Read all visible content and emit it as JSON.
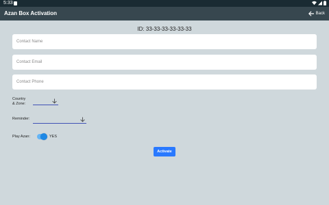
{
  "status_bar": {
    "time": "5:33",
    "icons": [
      "notification-icon",
      "wifi-icon",
      "cellular-icon",
      "battery-icon"
    ]
  },
  "app_bar": {
    "title": "Azan Box Activation",
    "back_label": "Back",
    "back_icon": "arrow-left-icon"
  },
  "device": {
    "id_text": "ID: 33-33-33-33-33-33"
  },
  "form": {
    "contact_name_placeholder": "Contact Name",
    "contact_email_placeholder": "Contact Email",
    "contact_phone_placeholder": "Contact Phone",
    "country_label_line1": "Country",
    "country_label_line2": "& Zone:",
    "reminder_label": "Reminder:",
    "play_azan_label": "Play Azan:",
    "play_azan_state": "YES",
    "play_azan_on": true
  },
  "actions": {
    "activate_label": "Activate"
  },
  "colors": {
    "background": "#cfd8dc",
    "app_bar": "#37474f",
    "status_bar": "#1a2b33",
    "accent": "#2979ff",
    "dropdown_underline": "#3f51b5"
  }
}
